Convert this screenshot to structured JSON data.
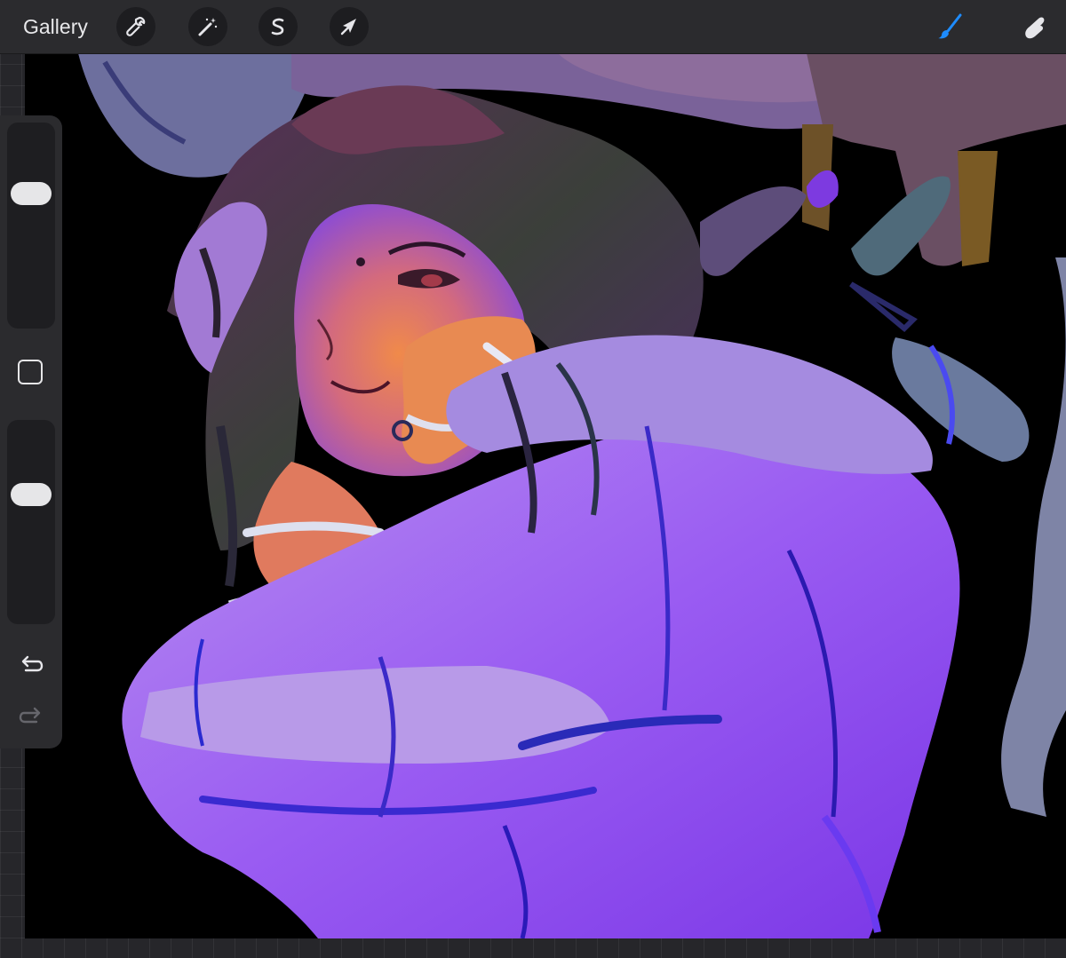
{
  "toolbar": {
    "gallery_label": "Gallery",
    "tools": [
      {
        "name": "actions",
        "icon": "wrench-icon"
      },
      {
        "name": "adjustments",
        "icon": "magic-wand-icon"
      },
      {
        "name": "selection",
        "icon": "selection-s-icon"
      },
      {
        "name": "transform",
        "icon": "arrow-cursor-icon"
      }
    ],
    "right_tools": [
      {
        "name": "brush",
        "icon": "brush-icon",
        "active": true,
        "color": "#1e8cff"
      },
      {
        "name": "smudge",
        "icon": "smudge-finger-icon",
        "active": false
      }
    ]
  },
  "sidebar": {
    "brush_size": 0.32,
    "opacity": 0.34,
    "modify_icon": "square-modify-icon",
    "undo_icon": "undo-icon",
    "redo_icon": "redo-icon",
    "redo_enabled": false
  },
  "canvas": {
    "background": "#000000",
    "artwork": "artwork-figure"
  },
  "colors": {
    "accent": "#1e8cff",
    "toolbar_bg": "#2b2b2e",
    "icon_bg": "#1d1d20"
  }
}
